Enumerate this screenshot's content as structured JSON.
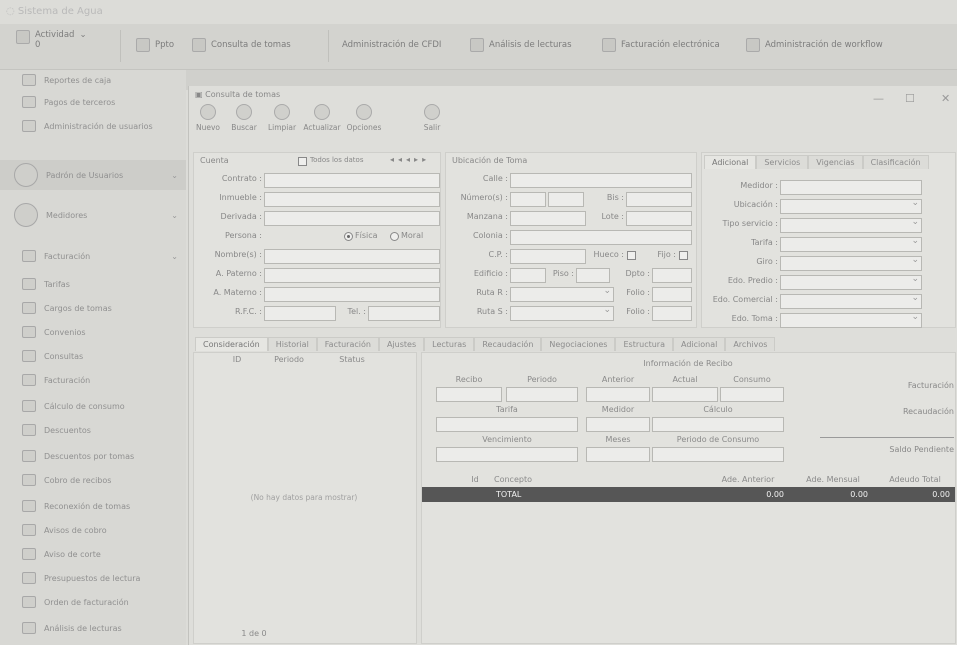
{
  "app_title": "Sistema de Agua",
  "toolbar": {
    "items": [
      {
        "label": "Actividad",
        "sub": "0"
      },
      {
        "label": "Ppto"
      },
      {
        "label": "Consulta de tomas"
      },
      {
        "label": "Administración de CFDI"
      },
      {
        "label": "Análisis de lecturas"
      },
      {
        "label": "Facturación electrónica"
      },
      {
        "label": "Administración de workflow"
      }
    ]
  },
  "sidebar": {
    "items": [
      "Reportes de caja",
      "Pagos de terceros",
      "Administración de usuarios",
      "Padrón de Usuarios",
      "Medidores",
      "Facturación",
      "Tarifas",
      "Cargos de tomas",
      "Convenios",
      "Consultas",
      "Facturación",
      "Cálculo de consumo",
      "Descuentos",
      "Descuentos por tomas",
      "Cobro de recibos",
      "Reconexión de tomas",
      "Avisos de cobro",
      "Aviso de corte",
      "Presupuestos de lectura",
      "Orden de facturación",
      "Análisis de lecturas"
    ]
  },
  "window": {
    "title": "Consulta de tomas",
    "controls": {
      "min": "—",
      "max": "☐",
      "close": "✕"
    },
    "toolbar": [
      "Nuevo",
      "Buscar",
      "Limpiar",
      "Actualizar",
      "Opciones",
      "Salir"
    ]
  },
  "cuenta": {
    "header": "Cuenta",
    "todos_label": "Todos los datos",
    "fields": [
      "Contrato :",
      "Inmueble :",
      "Derivada :",
      "Persona :",
      "Nombre(s) :",
      "A. Paterno :",
      "A. Materno :",
      "R.F.C. :"
    ],
    "tel_label": "Tel. :",
    "persona_options": [
      "Física",
      "Moral"
    ]
  },
  "ubicacion": {
    "header": "Ubicación de Toma",
    "calle": "Calle :",
    "numero": "Número(s) :",
    "bis": "Bis :",
    "manzana": "Manzana :",
    "lote": "Lote :",
    "colonia": "Colonia :",
    "cp": "C.P. :",
    "hueco": "Hueco :",
    "fijo": "Fijo :",
    "edificio": "Edificio :",
    "piso": "Piso :",
    "depto": "Dpto :",
    "ruta_r": "Ruta R :",
    "folio_r": "Folio :",
    "ruta_s": "Ruta S :",
    "folio_s": "Folio :"
  },
  "adicional": {
    "tabs": [
      "Adicional",
      "Servicios",
      "Vigencias",
      "Clasificación"
    ],
    "fields": [
      "Medidor :",
      "Ubicación :",
      "Tipo servicio :",
      "Tarifa :",
      "Giro :",
      "Edo. Predio :",
      "Edo. Comercial :",
      "Edo. Toma :"
    ]
  },
  "lower_tabs": [
    "Consideración",
    "Historial",
    "Facturación",
    "Ajustes",
    "Lecturas",
    "Recaudación",
    "Negociaciones",
    "Estructura",
    "Adicional",
    "Archivos"
  ],
  "grid": {
    "columns": [
      "ID",
      "Periodo",
      "Status"
    ],
    "empty_text": "(No hay datos para mostrar)",
    "pager": "1 de 0"
  },
  "recibo": {
    "title": "Información de Recibo",
    "row1": [
      "Recibo",
      "Periodo",
      "Anterior",
      "Actual",
      "Consumo"
    ],
    "row2": [
      "Tarifa",
      "Medidor",
      "Cálculo"
    ],
    "row3": [
      "Vencimiento",
      "Meses",
      "Periodo de Consumo"
    ],
    "right": [
      "Facturación",
      "Recaudación",
      "Saldo Pendiente"
    ]
  },
  "conceptos": {
    "columns": [
      "Id",
      "Concepto",
      "Ade. Anterior",
      "Ade. Mensual",
      "Adeudo Total"
    ],
    "total_label": "TOTAL",
    "totals": [
      "0.00",
      "0.00",
      "0.00"
    ]
  }
}
